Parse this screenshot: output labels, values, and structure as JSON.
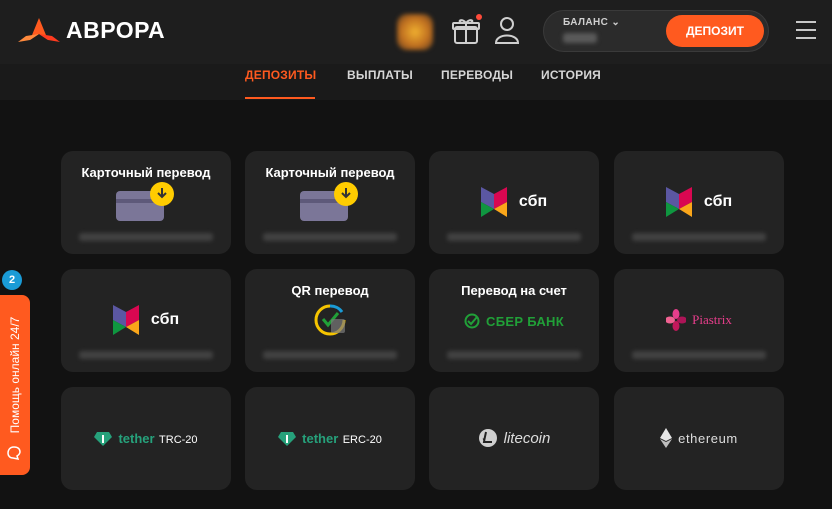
{
  "header": {
    "logo_text": "АВРОРА",
    "balance_label": "БАЛАНС",
    "deposit_button": "ДЕПОЗИТ"
  },
  "tabs": [
    {
      "label": "ДЕПОЗИТЫ",
      "active": true
    },
    {
      "label": "ВЫПЛАТЫ",
      "active": false
    },
    {
      "label": "ПЕРЕВОДЫ",
      "active": false
    },
    {
      "label": "ИСТОРИЯ",
      "active": false
    }
  ],
  "side_help": {
    "badge": "2",
    "label": "Помощь онлайн 24/7"
  },
  "cards": [
    {
      "title": "Карточный перевод",
      "brand": "card-transfer"
    },
    {
      "title": "Карточный перевод",
      "brand": "card-transfer"
    },
    {
      "title": "",
      "brand": "sbp",
      "brand_text": "сбп"
    },
    {
      "title": "",
      "brand": "sbp",
      "brand_text": "сбп"
    },
    {
      "title": "",
      "brand": "sbp",
      "brand_text": "сбп"
    },
    {
      "title": "QR перевод",
      "brand": "qr"
    },
    {
      "title": "Перевод на счет",
      "brand": "sber",
      "brand_text": "СБЕР БАНК"
    },
    {
      "title": "",
      "brand": "piastrix",
      "brand_text": "Piastrix"
    },
    {
      "title": "",
      "brand": "tether",
      "brand_text": "tether",
      "brand_sub": "TRC-20"
    },
    {
      "title": "",
      "brand": "tether",
      "brand_text": "tether",
      "brand_sub": "ERC-20"
    },
    {
      "title": "",
      "brand": "litecoin",
      "brand_text": "litecoin"
    },
    {
      "title": "",
      "brand": "ethereum",
      "brand_text": "ethereum"
    }
  ],
  "colors": {
    "accent": "#ff5a1f",
    "background": "#121212",
    "card": "#232323",
    "badge": "#1a9bd6"
  }
}
